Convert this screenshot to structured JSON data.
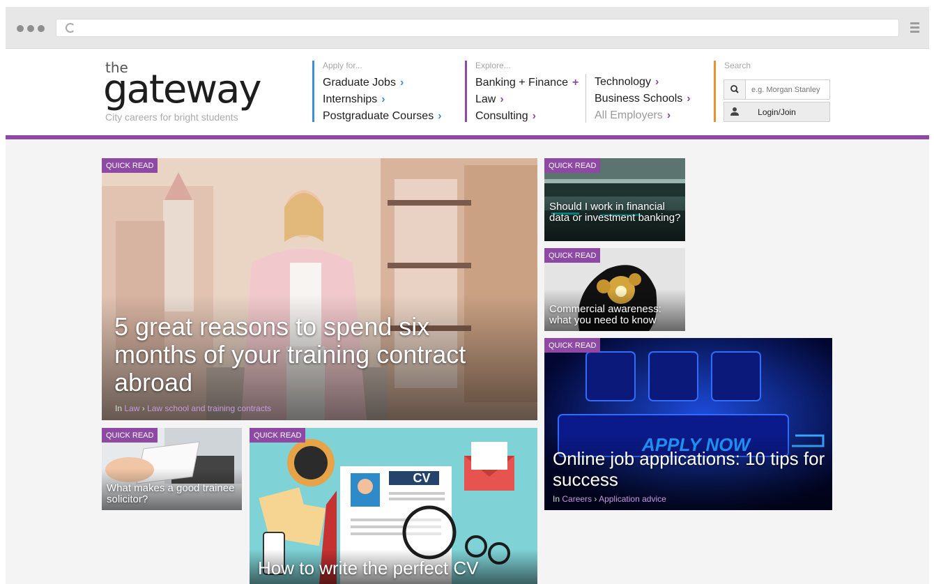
{
  "header": {
    "logo_the": "the",
    "logo_main": "gateway",
    "tagline": "City careers for bright students",
    "apply_heading": "Apply for...",
    "apply_links": [
      "Graduate Jobs",
      "Internships",
      "Postgraduate Courses"
    ],
    "explore_heading": "Explore...",
    "explore_links": [
      "Banking + Finance",
      "Law",
      "Consulting"
    ],
    "explore_links2": [
      "Technology",
      "Business Schools",
      "All Employers"
    ],
    "search_heading": "Search",
    "search_placeholder": "e.g. Morgan Stanley",
    "login_label": "Login/Join"
  },
  "colors": {
    "accent_purple": "#8d49a3",
    "apply_blue": "#3a8fd6",
    "search_orange": "#e8922f"
  },
  "icons": [
    "reload-icon",
    "menu-icon",
    "search-icon",
    "user-icon"
  ],
  "cards": {
    "main": {
      "tag": "QUICK READ",
      "title": "5 great reasons to spend six months of your training contract abroad",
      "meta_in": "In",
      "cat1": "Law",
      "sep": "›",
      "cat2": "Law school and training contracts"
    },
    "fin": {
      "tag": "QUICK READ",
      "title": "Should I work in financial data or investment banking?"
    },
    "comm": {
      "tag": "QUICK READ",
      "title": "Commercial awareness: what you need to know"
    },
    "online": {
      "tag": "QUICK READ",
      "title": "Online job applications: 10 tips for success",
      "apply_now": "APPLY NOW",
      "meta_in": "In",
      "cat1": "Careers",
      "sep": "›",
      "cat2": "Application advice"
    },
    "solicitor": {
      "tag": "QUICK READ",
      "title": "What makes a good trainee solicitor?"
    },
    "cv": {
      "tag": "QUICK READ",
      "title": "How to write the perfect CV",
      "cv_badge": "CV"
    }
  }
}
